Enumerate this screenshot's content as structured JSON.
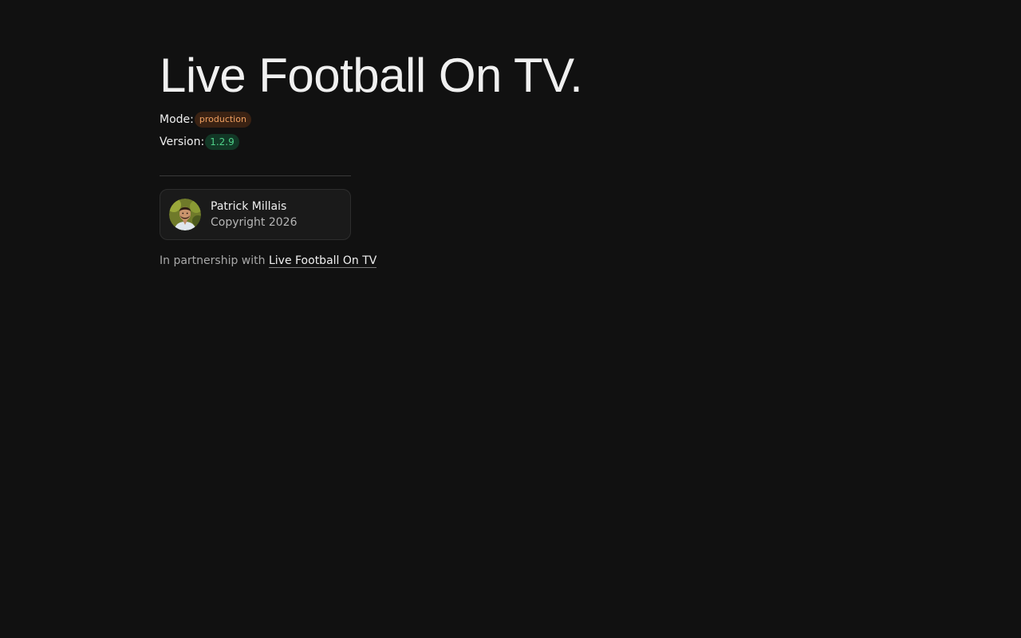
{
  "header": {
    "title": "Live Football On TV."
  },
  "meta": {
    "mode_label": "Mode:",
    "mode_value": "production",
    "version_label": "Version:",
    "version_value": "1.2.9"
  },
  "author": {
    "name": "Patrick Millais",
    "copyright": "Copyright 2026",
    "avatar_icon": "avatar-photo"
  },
  "footer": {
    "partner_prefix": "In partnership with",
    "partner_link": "Live Football On TV"
  },
  "colors": {
    "background": "#111111",
    "mode_badge_bg": "#3a2213",
    "mode_badge_text": "#f0a060",
    "version_badge_bg": "#123826",
    "version_badge_text": "#4fd189"
  }
}
